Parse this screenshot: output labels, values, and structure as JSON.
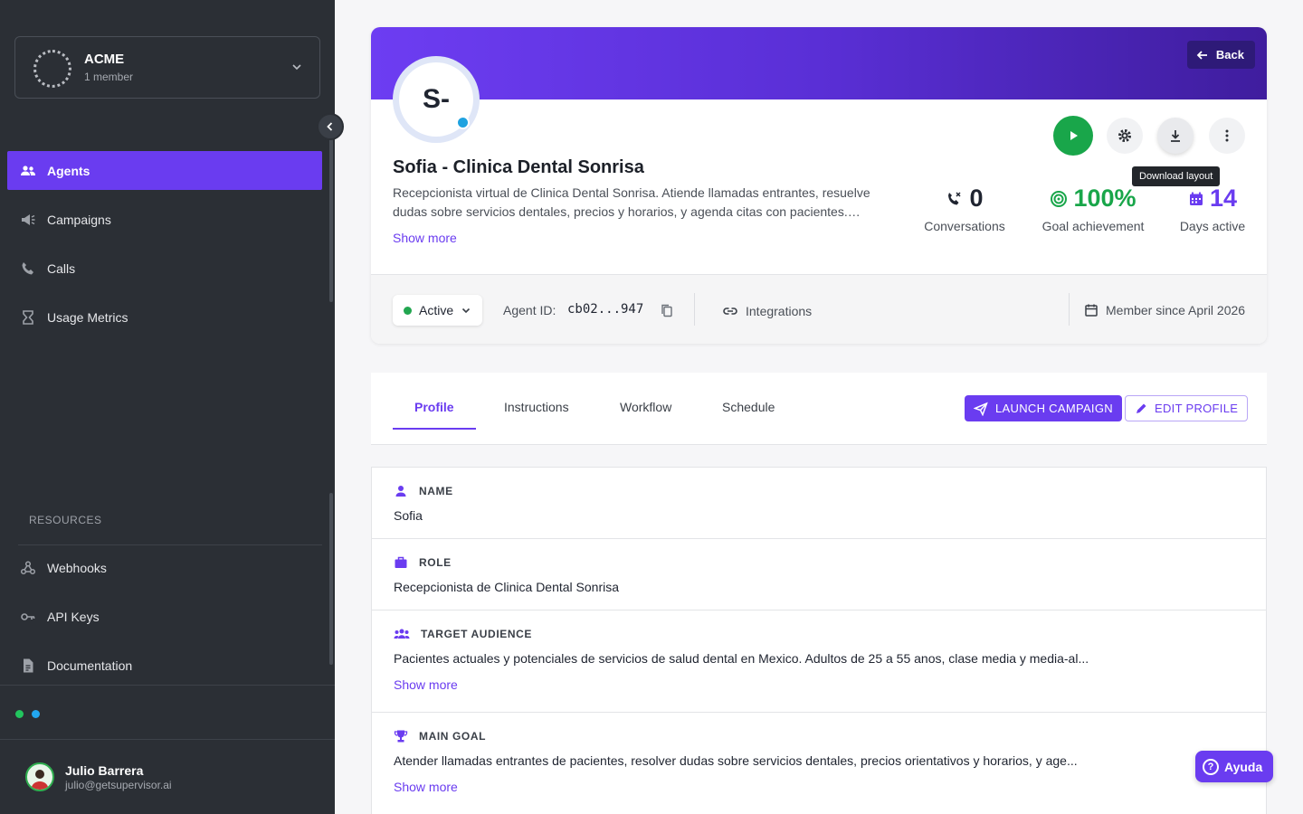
{
  "org": {
    "name": "ACME",
    "members": "1 member"
  },
  "nav": {
    "items": [
      {
        "label": "Agents"
      },
      {
        "label": "Campaigns"
      },
      {
        "label": "Calls"
      },
      {
        "label": "Usage Metrics"
      }
    ],
    "resources_label": "RESOURCES",
    "resources": [
      {
        "label": "Webhooks"
      },
      {
        "label": "API Keys"
      },
      {
        "label": "Documentation"
      }
    ]
  },
  "user": {
    "name": "Julio Barrera",
    "email": "julio@getsupervisor.ai"
  },
  "header": {
    "back_label": "Back",
    "avatar_initials": "S-",
    "title": "Sofia - Clinica Dental Sonrisa",
    "description": "Recepcionista virtual de Clinica Dental Sonrisa. Atiende llamadas entrantes, resuelve dudas sobre servicios dentales, precios y horarios, y agenda citas con pacientes.…",
    "show_more": "Show more",
    "tooltip": "Download layout",
    "stats": [
      {
        "value": "0",
        "label": "Conversations",
        "color": "#1f2430"
      },
      {
        "value": "100%",
        "label": "Goal achievement",
        "color": "#19a64a"
      },
      {
        "value": "14",
        "label": "Days active",
        "color": "#6a3cf0"
      }
    ],
    "status": "Active",
    "agent_id_label": "Agent ID:",
    "agent_id": "cb02...947",
    "integrations": "Integrations",
    "member_since": "Member since April 2026"
  },
  "tabs": [
    {
      "label": "Profile"
    },
    {
      "label": "Instructions"
    },
    {
      "label": "Workflow"
    },
    {
      "label": "Schedule"
    }
  ],
  "actions": {
    "launch": "LAUNCH CAMPAIGN",
    "edit": "EDIT PROFILE"
  },
  "fields": {
    "name": {
      "label": "NAME",
      "value": "Sofia"
    },
    "role": {
      "label": "ROLE",
      "value": "Recepcionista de Clinica Dental Sonrisa"
    },
    "audience": {
      "label": "TARGET AUDIENCE",
      "value": "Pacientes actuales y potenciales de servicios de salud dental en Mexico. Adultos de 25 a 55 anos, clase media y media-al...",
      "more": "Show more"
    },
    "goal": {
      "label": "MAIN GOAL",
      "value": "Atender llamadas entrantes de pacientes, resolver dudas sobre servicios dentales, precios orientativos y horarios, y age...",
      "more": "Show more"
    }
  },
  "help": {
    "label": "Ayuda"
  },
  "colors": {
    "accent": "#6a3cf0",
    "sidebar": "#2b2f35",
    "success": "#19a64a"
  }
}
